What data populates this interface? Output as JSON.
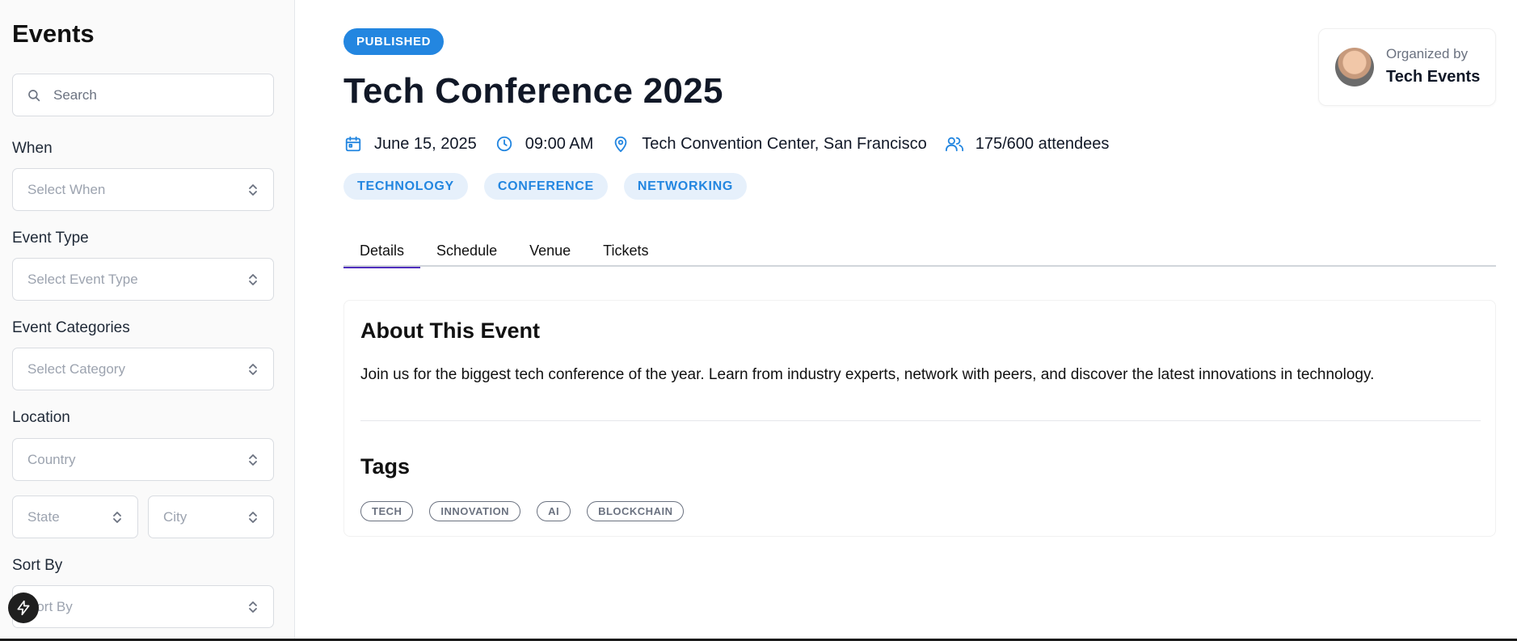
{
  "sidebar": {
    "title": "Events",
    "search": {
      "placeholder": "Search",
      "value": ""
    },
    "filters": {
      "when": {
        "label": "When",
        "placeholder": "Select When"
      },
      "event_type": {
        "label": "Event Type",
        "placeholder": "Select Event Type"
      },
      "categories": {
        "label": "Event Categories",
        "placeholder": "Select Category"
      },
      "location": {
        "label": "Location",
        "country_placeholder": "Country",
        "state_placeholder": "State",
        "city_placeholder": "City"
      },
      "sort_by": {
        "label": "Sort By",
        "placeholder": "Sort By"
      }
    }
  },
  "event": {
    "status": "PUBLISHED",
    "title": "Tech Conference 2025",
    "date": "June 15, 2025",
    "time": "09:00 AM",
    "venue": "Tech Convention Center, San Francisco",
    "attendees": "175/600 attendees",
    "categories": [
      "TECHNOLOGY",
      "CONFERENCE",
      "NETWORKING"
    ]
  },
  "organizer": {
    "label": "Organized by",
    "name": "Tech Events"
  },
  "tabs": [
    "Details",
    "Schedule",
    "Venue",
    "Tickets"
  ],
  "active_tab": "Details",
  "details": {
    "about_title": "About This Event",
    "about_text": "Join us for the biggest tech conference of the year. Learn from industry experts, network with peers, and discover the latest innovations in technology.",
    "tags_title": "Tags",
    "tags": [
      "TECH",
      "INNOVATION",
      "AI",
      "BLOCKCHAIN"
    ]
  },
  "colors": {
    "accent": "#2386e0",
    "accent_light": "#e6f0fb",
    "tab_underline": "#4f2ebd"
  },
  "icons": [
    "search-icon",
    "chevron-updown-icon",
    "calendar-icon",
    "clock-icon",
    "map-pin-icon",
    "users-icon",
    "bolt-icon"
  ]
}
